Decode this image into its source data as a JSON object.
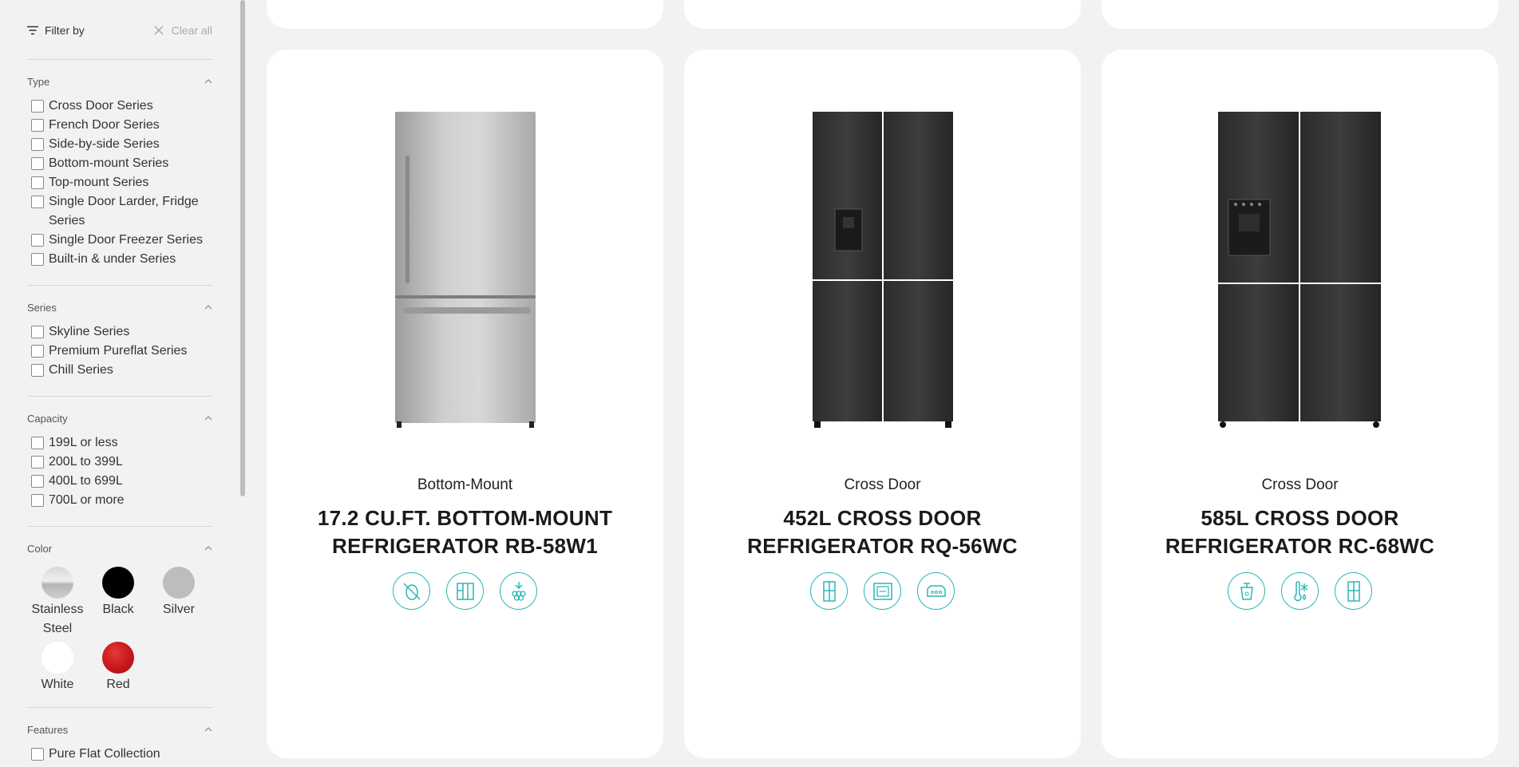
{
  "sidebar": {
    "filter_by": "Filter by",
    "clear_all": "Clear all",
    "sections": {
      "type": {
        "title": "Type",
        "options": [
          "Cross Door Series",
          "French Door Series",
          "Side-by-side Series",
          "Bottom-mount Series",
          "Top-mount Series",
          "Single Door Larder, Fridge Series",
          "Single Door Freezer Series",
          "Built-in & under Series"
        ]
      },
      "series": {
        "title": "Series",
        "options": [
          "Skyline Series",
          "Premium Pureflat Series",
          "Chill Series"
        ]
      },
      "capacity": {
        "title": "Capacity",
        "options": [
          "199L or less",
          "200L to 399L",
          "400L to 699L",
          "700L or more"
        ]
      },
      "color": {
        "title": "Color",
        "options": [
          {
            "label": "Stainless Steel",
            "color": "#c9c9c9"
          },
          {
            "label": "Black",
            "color": "#000000"
          },
          {
            "label": "Silver",
            "color": "#bdbdbd"
          },
          {
            "label": "White",
            "color": "#ffffff"
          },
          {
            "label": "Red",
            "color": "#c8161d"
          }
        ]
      },
      "features": {
        "title": "Features",
        "options": [
          "Pure Flat Collection"
        ]
      }
    }
  },
  "products": [
    {
      "category": "Bottom-Mount",
      "name": "17.2 CU.FT. BOTTOM-MOUNT REFRIGERATOR RB-58W1",
      "icons": [
        "frost-free-icon",
        "multi-door-icon",
        "ice-maker-icon"
      ]
    },
    {
      "category": "Cross Door",
      "name": "452L CROSS DOOR REFRIGERATOR RQ-56WC",
      "icons": [
        "cross-door-icon",
        "capacity-icon",
        "drawer-icon"
      ]
    },
    {
      "category": "Cross Door",
      "name": "585L CROSS DOOR REFRIGERATOR RC-68WC",
      "icons": [
        "water-dispenser-icon",
        "temperature-icon",
        "cross-door-icon"
      ]
    }
  ],
  "colors": {
    "accent": "#2bb5b5",
    "background": "#f2f2f2",
    "card": "#ffffff"
  }
}
